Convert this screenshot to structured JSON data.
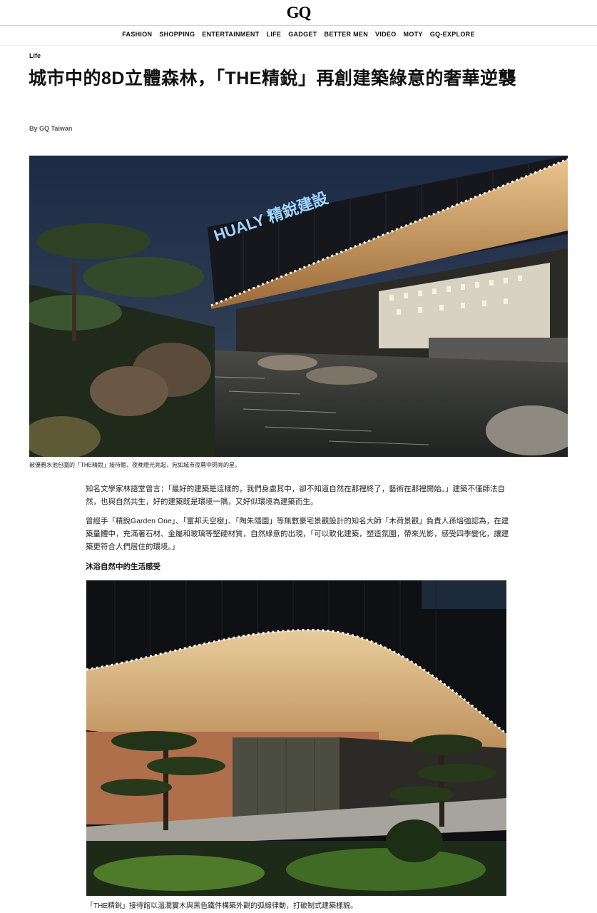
{
  "logo": "GQ",
  "nav": [
    "FASHION",
    "SHOPPING",
    "ENTERTAINMENT",
    "LIFE",
    "GADGET",
    "BETTER MEN",
    "VIDEO",
    "MOTY",
    "GQ-EXPLORE"
  ],
  "article": {
    "section": "Life",
    "title": "城市中的8D立體森林，「THE精銳」再創建築綠意的奢華逆襲",
    "byline": "By GQ Taiwan",
    "image1_sign": "HUALY 精銳建設",
    "caption1": "被優雅水池包圍的「THE精銳」接待館，夜晚燈光亮起，宛如城市夜幕中閃亮的星。",
    "paragraph1": "知名文學家林語堂曾言：「最好的建築是這樣的，我們身處其中，卻不知道自然在那裡終了，藝術在那裡開始。」建築不僅師法自然，也與自然共生，好的建築既是環境一隅，又好似環境為建築而生。",
    "paragraph2": "曾經手「精銳Garden One」、「富邦天空樹」、「陶朱隱園」等無數豪宅景觀設計的知名大師「木荷景觀」負責人孫培強認為，在建築量體中，充滿著石材、金屬和玻璃等堅硬材質，自然綠意的出現，「可以軟化建築，塑造氛圍，帶來光影，感受四季變化，讓建築更符合人們居住的環境。」",
    "subheading": "沐浴自然中的生活感受",
    "caption2": "「THE精銳」接待館以溫潤實木與黑色鐵件構築外觀的弧線律動，打破制式建築樣貌。"
  }
}
